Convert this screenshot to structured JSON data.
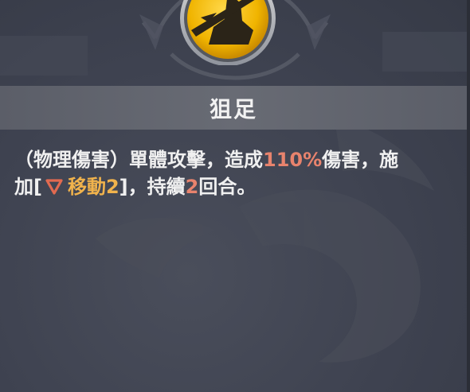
{
  "skill": {
    "name": "狙足",
    "icon": "sniper-shot-icon"
  },
  "description": {
    "line1_prefix": "（物理傷害）單體攻擊，造成",
    "damage_value": "110%",
    "line1_suffix": "傷害，施",
    "line2_prefix": "加[",
    "debuff_icon": "down-triangle-icon",
    "debuff_name": "移動",
    "debuff_level": "2",
    "line2_mid": "]，持續",
    "duration_value": "2",
    "line2_suffix": "回合。"
  },
  "colors": {
    "background": "#3f4350",
    "title_bar": "#666972",
    "highlight_red": "#e8836d",
    "highlight_gold": "#f1b34c",
    "icon_gold": "#f0b800"
  }
}
